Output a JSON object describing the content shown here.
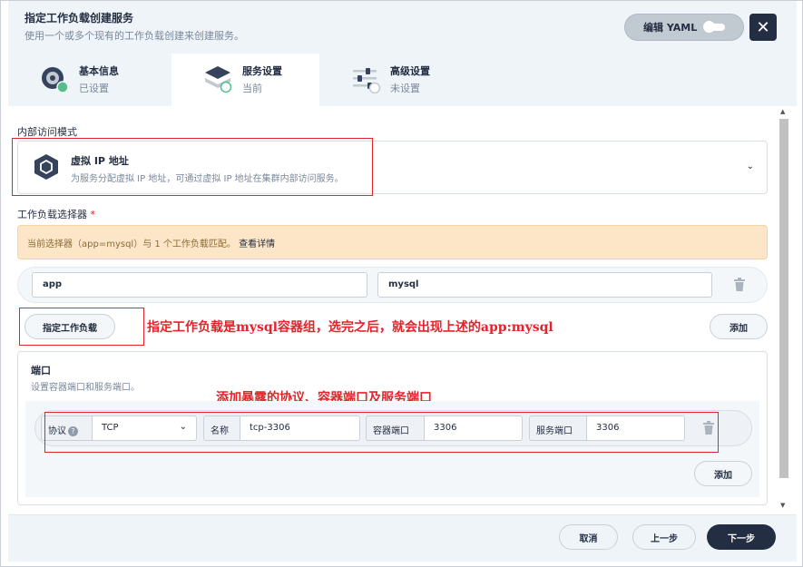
{
  "header": {
    "title": "指定工作负载创建服务",
    "subtitle": "使用一个或多个现有的工作负载创建来创建服务。",
    "yaml_label": "编辑 YAML"
  },
  "tabs": [
    {
      "label": "基本信息",
      "status": "已设置",
      "icon": "basic-info-icon"
    },
    {
      "label": "服务设置",
      "status": "当前",
      "icon": "service-settings-icon"
    },
    {
      "label": "高级设置",
      "status": "未设置",
      "icon": "advanced-settings-icon"
    }
  ],
  "access_mode": {
    "label": "内部访问模式",
    "option_title": "虚拟 IP 地址",
    "option_desc": "为服务分配虚拟 IP 地址，可通过虚拟 IP 地址在集群内部访问服务。"
  },
  "selector": {
    "label": "工作负载选择器",
    "required_mark": "*",
    "notice": "当前选择器（app=mysql）与 1 个工作负载匹配。",
    "notice_link": "查看详情",
    "key": "app",
    "value": "mysql",
    "specify_button": "指定工作负载",
    "add_button": "添加"
  },
  "ports": {
    "title": "端口",
    "subtitle": "设置容器端口和服务端口。",
    "protocol_label": "协议",
    "protocol_help": "?",
    "protocol_value": "TCP",
    "name_label": "名称",
    "name_value": "tcp-3306",
    "container_port_label": "容器端口",
    "container_port_value": "3306",
    "service_port_label": "服务端口",
    "service_port_value": "3306",
    "add_button": "添加"
  },
  "annotations": {
    "workload_note": "指定工作负载是mysql容器组，选完之后，就会出现上述的app:mysql",
    "ports_note": "添加暴露的协议、容器端口及服务端口"
  },
  "footer": {
    "cancel": "取消",
    "previous": "上一步",
    "next": "下一步"
  },
  "colors": {
    "dark": "#242e42",
    "annotation_red": "#e2242b",
    "warning_bg": "#fde6c8",
    "success_green": "#55bc8a"
  }
}
